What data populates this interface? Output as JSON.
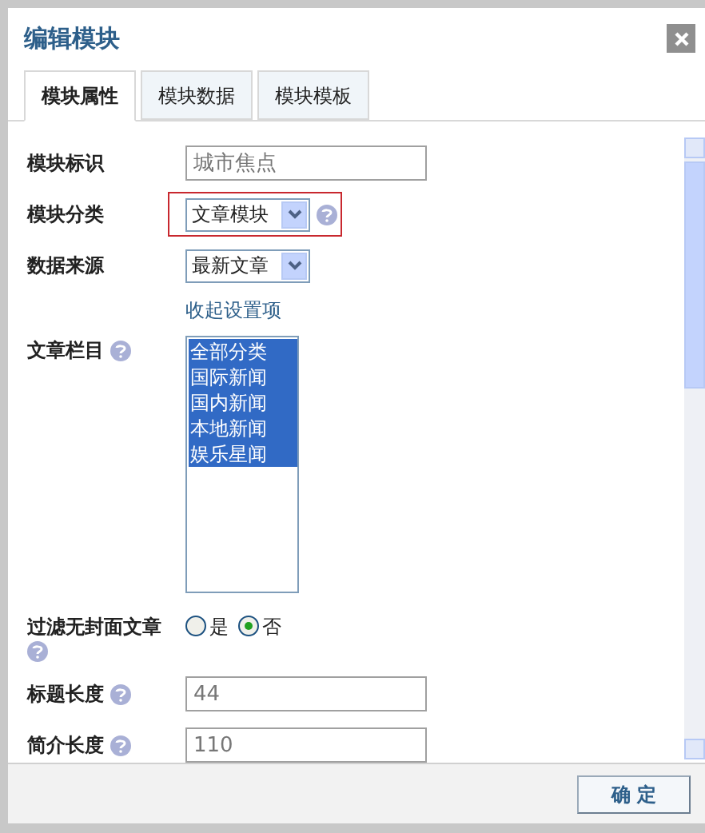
{
  "dialog": {
    "title": "编辑模块",
    "tabs": [
      {
        "label": "模块属性",
        "selected": true
      },
      {
        "label": "模块数据",
        "selected": false
      },
      {
        "label": "模块模板",
        "selected": false
      }
    ],
    "fields": [
      {
        "kind": "text",
        "label": "模块标识",
        "help": false,
        "value": "城市焦点"
      },
      {
        "kind": "select",
        "label": "模块分类",
        "help": true,
        "value": "文章模块",
        "highlighted": true
      },
      {
        "kind": "select",
        "label": "数据来源",
        "help": false,
        "value": "最新文章",
        "highlighted": false
      },
      {
        "kind": "link",
        "text": "收起设置项"
      },
      {
        "kind": "listbox",
        "label": "文章栏目",
        "help": true,
        "options": [
          {
            "text": "全部分类",
            "selected": true
          },
          {
            "text": "国际新闻",
            "selected": true
          },
          {
            "text": "国内新闻",
            "selected": true
          },
          {
            "text": "本地新闻",
            "selected": true
          },
          {
            "text": "娱乐星闻",
            "selected": true
          }
        ]
      },
      {
        "kind": "radio",
        "label": "过滤无封面文章",
        "help": true,
        "options": [
          {
            "text": "是",
            "selected": false
          },
          {
            "text": "否",
            "selected": true
          }
        ]
      },
      {
        "kind": "text",
        "label": "标题长度",
        "help": true,
        "value": "44"
      },
      {
        "kind": "text",
        "label": "简介长度",
        "help": true,
        "value": "110"
      }
    ],
    "confirm_button": "确 定"
  }
}
